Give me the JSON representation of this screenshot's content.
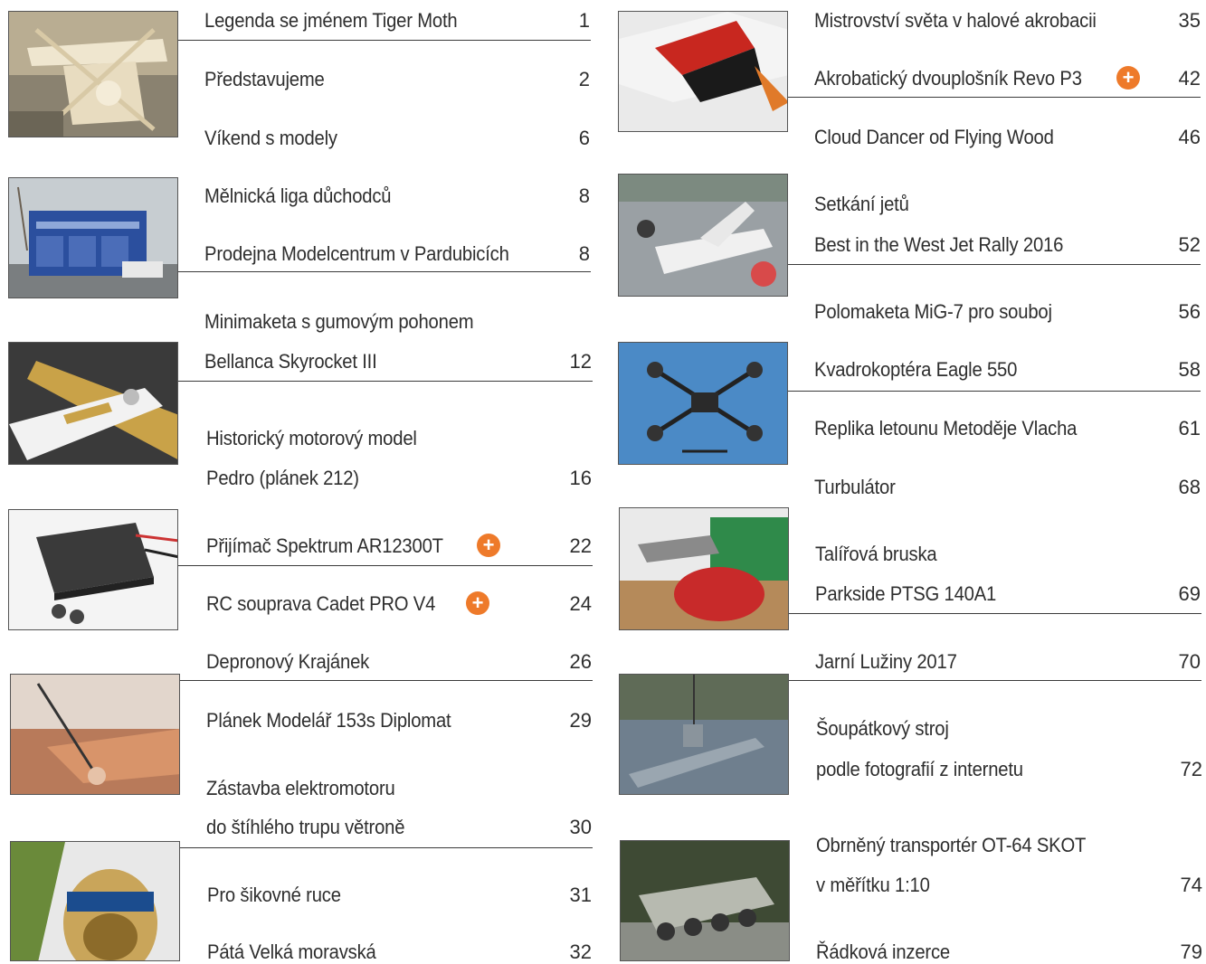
{
  "left_column": [
    {
      "title": "Legenda se jménem Tiger Moth",
      "page": "1"
    },
    {
      "title": "Představujeme",
      "page": "2"
    },
    {
      "title": "Víkend s modely",
      "page": "6"
    },
    {
      "title": "Mělnická liga důchodců",
      "page": "8"
    },
    {
      "title": "Prodejna Modelcentrum v Pardubicích",
      "page": "8"
    },
    {
      "title": "Minimaketa s gumovým pohonem",
      "page": ""
    },
    {
      "title": "Bellanca Skyrocket III",
      "page": "12"
    },
    {
      "title": "Historický motorový model",
      "page": ""
    },
    {
      "title": "Pedro (plánek 212)",
      "page": "16"
    },
    {
      "title": "Přijímač Spektrum AR12300T",
      "page": "22",
      "badge": "+"
    },
    {
      "title": "RC souprava Cadet PRO V4",
      "page": "24",
      "badge": "+"
    },
    {
      "title": "Depronový Krajánek",
      "page": "26"
    },
    {
      "title": "Plánek Modelář 153s Diplomat",
      "page": "29"
    },
    {
      "title": "Zástavba elektromotoru",
      "page": ""
    },
    {
      "title": "do štíhlého trupu větroně",
      "page": "30"
    },
    {
      "title": "Pro šikovné ruce",
      "page": "31"
    },
    {
      "title": "Pátá Velká moravská",
      "page": "32"
    }
  ],
  "right_column": [
    {
      "title": "Mistrovství světa v halové akrobacii",
      "page": "35"
    },
    {
      "title": "Akrobatický dvouplošník Revo P3",
      "page": "42",
      "badge": "+"
    },
    {
      "title": "Cloud Dancer od Flying Wood",
      "page": "46"
    },
    {
      "title": "Setkání jetů",
      "page": ""
    },
    {
      "title": "Best in the West Jet Rally 2016",
      "page": "52"
    },
    {
      "title": "Polomaketa MiG-7 pro souboj",
      "page": "56"
    },
    {
      "title": "Kvadrokoptéra Eagle 550",
      "page": "58"
    },
    {
      "title": "Replika letounu Metoděje Vlacha",
      "page": "61"
    },
    {
      "title": "Turbulátor",
      "page": "68"
    },
    {
      "title": "Talířová bruska",
      "page": ""
    },
    {
      "title": "Parkside PTSG 140A1",
      "page": "69"
    },
    {
      "title": "Jarní Lužiny 2017",
      "page": "70"
    },
    {
      "title": "Šoupátkový stroj",
      "page": ""
    },
    {
      "title": "podle fotografií z internetu",
      "page": "72"
    },
    {
      "title": "Obrněný transportér OT-64 SKOT",
      "page": ""
    },
    {
      "title": "v měřítku 1:10",
      "page": "74"
    },
    {
      "title": "Řádková inzerce",
      "page": "79"
    }
  ],
  "photos": [
    {
      "subject": "tiger-moth-photo"
    },
    {
      "subject": "modelcentrum-store-photo"
    },
    {
      "subject": "bellanca-model-photo"
    },
    {
      "subject": "spektrum-receiver-photo"
    },
    {
      "subject": "glider-fuselage-photo"
    },
    {
      "subject": "electric-motor-photo"
    },
    {
      "subject": "acrobatic-plane-photo"
    },
    {
      "subject": "jet-rally-photo"
    },
    {
      "subject": "quadcopter-photo"
    },
    {
      "subject": "angle-grinder-photo"
    },
    {
      "subject": "submarine-model-photo"
    },
    {
      "subject": "ot64-skot-model-photo"
    }
  ],
  "colors": {
    "badge": "#ee7a2a",
    "rule": "#3a3a3a",
    "text": "#2e2e2e"
  }
}
